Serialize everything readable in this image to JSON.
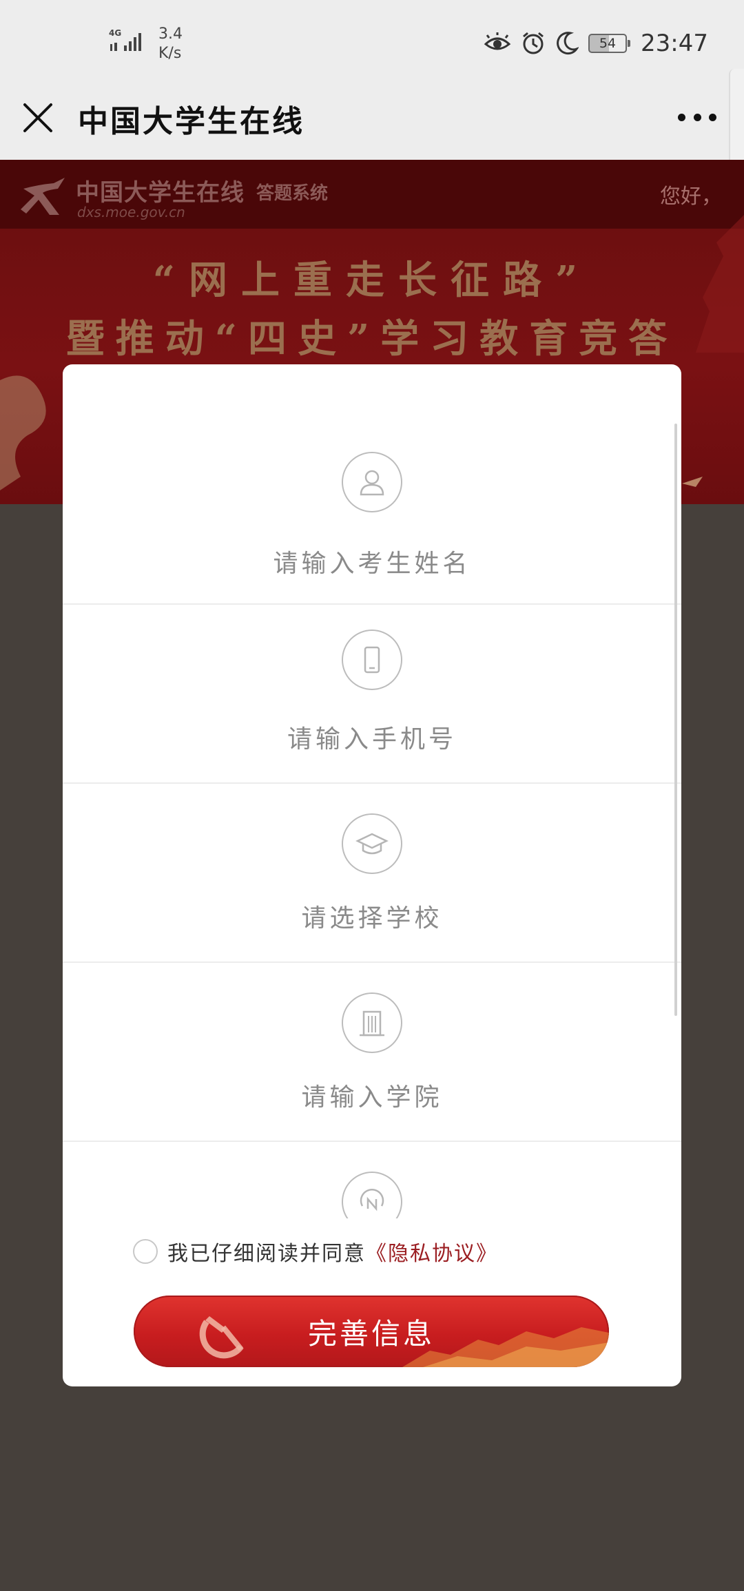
{
  "status_bar": {
    "network": "4G",
    "speed": "3.4",
    "speed_unit": "K/s",
    "battery": "54",
    "time": "23:47"
  },
  "nav": {
    "title": "中国大学生在线"
  },
  "banner": {
    "logo_text": "中国大学生在线",
    "logo_sub": "答题系统",
    "logo_url": "dxs.moe.gov.cn",
    "greeting": "您好，",
    "line1": "“网上重走长征路”",
    "line2": "暨推动“四史”学习教育竞答"
  },
  "form": {
    "fields": [
      {
        "label": "请输入考生姓名",
        "icon": "user-icon"
      },
      {
        "label": "请输入手机号",
        "icon": "phone-icon"
      },
      {
        "label": "请选择学校",
        "icon": "graduation-cap-icon"
      },
      {
        "label": "请输入学院",
        "icon": "building-icon"
      },
      {
        "label": "",
        "icon": "id-icon"
      }
    ],
    "agree_text": "我已仔细阅读并同意",
    "agree_link": "《隐私协议》",
    "submit": "完善信息"
  },
  "colors": {
    "banner_red": "#7a1113",
    "accent_red": "#c81d1f",
    "link_red": "#9b1e22"
  }
}
